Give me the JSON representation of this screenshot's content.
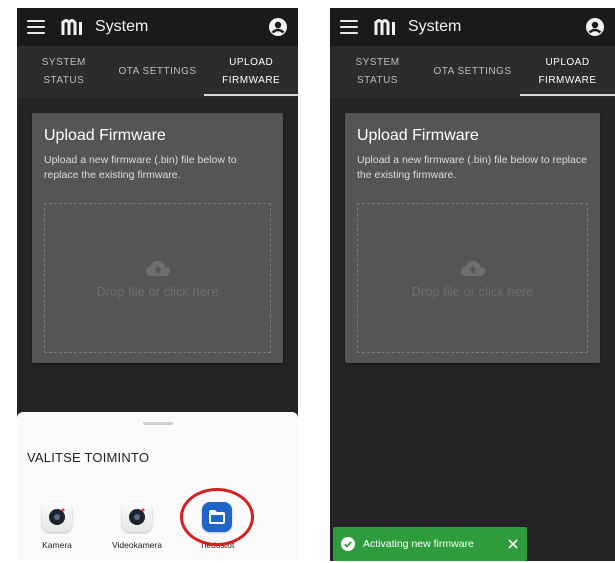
{
  "app_bar": {
    "title": "System",
    "menu_icon": "hamburger-menu-icon",
    "logo_icon": "m-logo-icon",
    "account_icon": "account-circle-icon"
  },
  "tabs": [
    {
      "label": "SYSTEM STATUS",
      "active": false
    },
    {
      "label": "OTA SETTINGS",
      "active": false
    },
    {
      "label": "UPLOAD FIRMWARE",
      "active": true
    }
  ],
  "upload_card": {
    "title": "Upload Firmware",
    "description": "Upload a new firmware (.bin) file below to replace the existing firmware.",
    "dropzone_text": "Drop file or click here",
    "dropzone_icon": "cloud-upload-icon"
  },
  "bottom_sheet": {
    "title": "VALITSE TOIMINTO",
    "apps": [
      {
        "label": "Kamera",
        "icon": "camera-icon"
      },
      {
        "label": "Videokamera",
        "icon": "video-camera-icon"
      },
      {
        "label": "Tiedostot",
        "icon": "folder-icon",
        "highlighted": true
      }
    ]
  },
  "toast": {
    "message": "Activating new firmware",
    "icon": "check-circle-icon",
    "close_icon": "close-icon",
    "color": "#2e9b3d"
  },
  "colors": {
    "background": "#242424",
    "appbar": "#1a1a1a",
    "card": "#555555",
    "highlight": "#d62020"
  }
}
